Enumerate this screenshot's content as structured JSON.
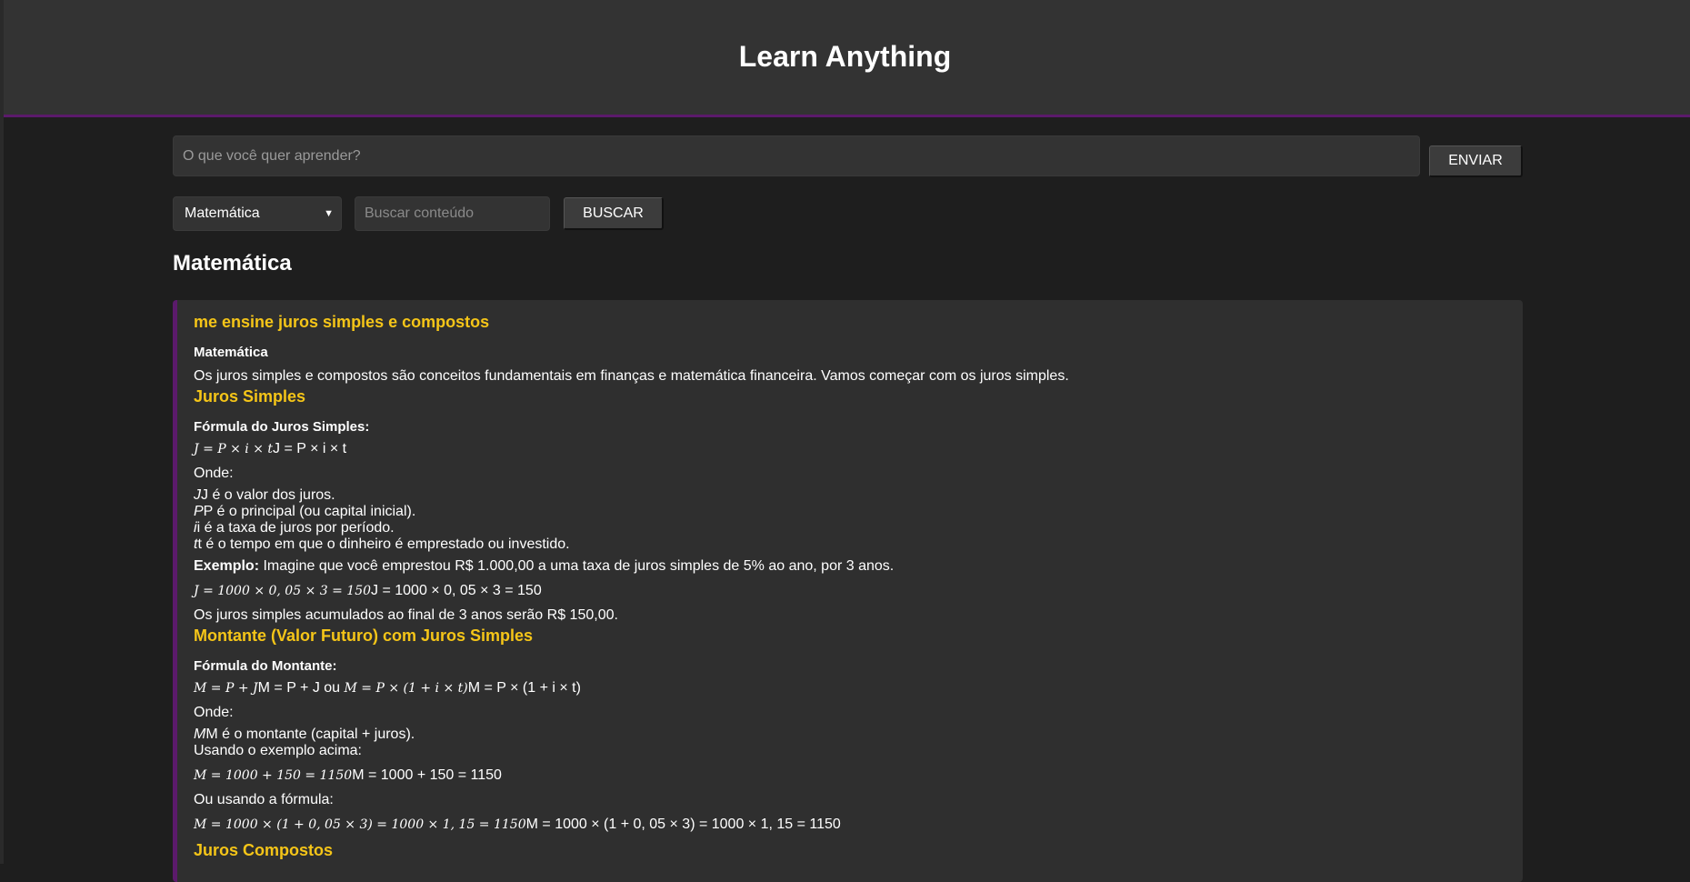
{
  "app": {
    "title": "Learn Anything"
  },
  "ask": {
    "placeholder": "O que você quer aprender?",
    "send_label": "ENVIAR"
  },
  "filter": {
    "subject_selected": "Matemática",
    "search_placeholder": "Buscar conteúdo",
    "search_label": "BUSCAR"
  },
  "section": {
    "title": "Matemática"
  },
  "card": {
    "question": "me ensine juros simples e compostos",
    "category": "Matemática",
    "intro": "Os juros simples e compostos são conceitos fundamentais em finanças e matemática financeira. Vamos começar com os juros simples.",
    "h_simples": "Juros Simples",
    "formula_simples_label": "Fórmula do Juros Simples:",
    "formula_simples_math": "J = P × i × t",
    "formula_simples_text": "J = P × i × t",
    "onde1": "Onde:",
    "defs1": [
      {
        "sym": "J",
        "text": "J  é o valor dos juros."
      },
      {
        "sym": "P",
        "text": "P  é o principal (ou capital inicial)."
      },
      {
        "sym": "i",
        "text": "i é a taxa de juros por período."
      },
      {
        "sym": "t",
        "text": "t é o tempo em que o dinheiro é emprestado ou investido."
      }
    ],
    "exemplo_label": "Exemplo:",
    "exemplo_text": " Imagine que você emprestou R$ 1.000,00 a uma taxa de juros simples de 5% ao ano, por 3 anos.",
    "exemplo_math": "J = 1000 × 0, 05 × 3 = 150",
    "exemplo_math_text": "J = 1000 × 0, 05 × 3 = 150",
    "resultado_simples": "Os juros simples acumulados ao final de 3 anos serão R$ 150,00.",
    "h_montante": "Montante (Valor Futuro) com Juros Simples",
    "formula_montante_label": "Fórmula do Montante:",
    "montante_math_1": "M = P + J",
    "montante_text_1": "M = P + J ou ",
    "montante_math_2": "M = P × (1 + i × t)",
    "montante_text_2": "M = P × (1 + i × t)",
    "onde2": "Onde:",
    "def_m_sym": "M",
    "def_m_text": "M  é o montante (capital + juros).",
    "usando": "Usando o exemplo acima:",
    "usando_math": "M = 1000 + 150 = 1150",
    "usando_text": "M = 1000 + 150 = 1150",
    "ou_formula": "Ou usando a fórmula:",
    "ou_math": "M = 1000 × (1 + 0, 05 × 3) = 1000 × 1, 15 = 1150",
    "ou_text": "M = 1000 × (1 + 0, 05 × 3) = 1000 × 1, 15 = 1150",
    "h_compostos": "Juros Compostos"
  }
}
